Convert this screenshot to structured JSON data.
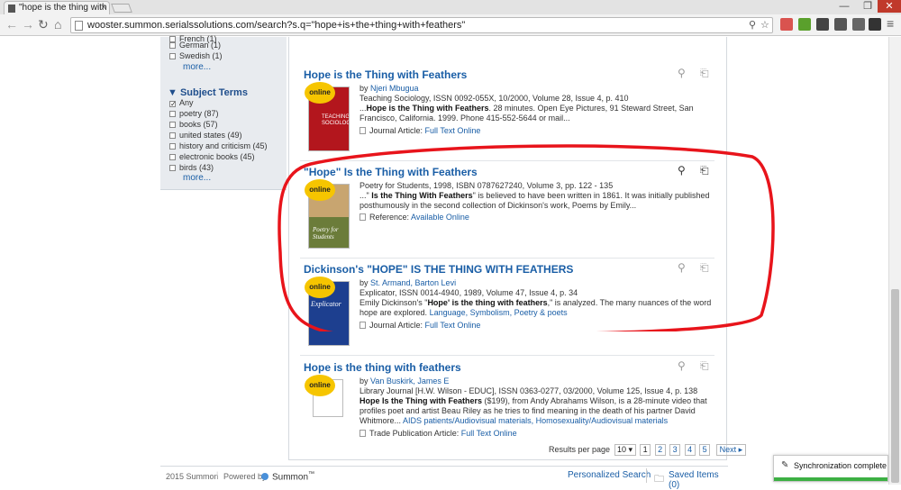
{
  "browser": {
    "tab_title": "\"hope is the thing with fe",
    "tab_close": "×",
    "url": "wooster.summon.serialssolutions.com/search?s.q=\"hope+is+the+thing+with+feathers\"",
    "window_controls": [
      "—",
      "❐",
      "✕"
    ]
  },
  "sidebar": {
    "language_items": [
      {
        "label": "French (1)"
      },
      {
        "label": "German (1)"
      },
      {
        "label": "Swedish (1)"
      }
    ],
    "language_more": "more...",
    "subject_heading": "Subject Terms",
    "subject_items": [
      {
        "label": "Any",
        "checked": true
      },
      {
        "label": "poetry (87)",
        "checked": false
      },
      {
        "label": "books (57)",
        "checked": false
      },
      {
        "label": "united states (49)",
        "checked": false
      },
      {
        "label": "history and criticism (45)",
        "checked": false
      },
      {
        "label": "electronic books (45)",
        "checked": false
      },
      {
        "label": "birds (43)",
        "checked": false
      }
    ],
    "subject_more": "more..."
  },
  "results": [
    {
      "title": "Hope is the Thing with Feathers",
      "badge": "online",
      "authors_prefix": "by ",
      "authors": "Njeri Mbugua",
      "source": "Teaching Sociology, ISSN 0092-055X, 10/2000, Volume 28, Issue 4, p. 410",
      "snippet_pre": "...",
      "snippet_bold": "Hope is the Thing with Feathers",
      "snippet_post": ". 28 minutes. Open Eye Pictures, 91 Steward Street, San Francisco, California. 1999. Phone 415-552-5644 or mail...",
      "type": "Journal Article:",
      "access": "Full Text Online",
      "cover_color": "#b3161d",
      "cover_text": "TEACHING SOCIOLOGY"
    },
    {
      "title": "\"Hope\" Is the Thing with Feathers",
      "badge": "online",
      "source": "Poetry for Students, 1998, ISBN 0787627240, Volume 3, pp. 122 - 135",
      "snippet_pre": "...\"",
      "snippet_bold": " Is the Thing With Feathers",
      "snippet_post": "\" is believed to have been written in 1861. It was initially published posthumously in the second collection of Dickinson's work, Poems by Emily...",
      "type": "Reference:",
      "access": "Available Online",
      "cover_color": "#6b7c3a",
      "cover_text": "Poetry for Students"
    },
    {
      "title": "Dickinson's \"HOPE\" IS THE THING WITH FEATHERS",
      "badge": "online",
      "authors_prefix": "by ",
      "authors": "St. Armand, Barton Levi",
      "source": "Explicator, ISSN 0014-4940, 1989, Volume 47, Issue 4, p. 34",
      "snippet_pre": "Emily Dickinson's \"",
      "snippet_bold": "Hope' is the thing with feathers",
      "snippet_post": ",\" is analyzed. The many nuances of the word hope are explored. ",
      "subjects": "Language, Symbolism, Poetry & poets",
      "type": "Journal Article:",
      "access": "Full Text Online",
      "cover_color": "#1d3f8f",
      "cover_text": "Explicator"
    },
    {
      "title": "Hope is the thing with feathers",
      "badge": "online",
      "authors_prefix": "by ",
      "authors": "Van Buskirk, James E",
      "source": "Library Journal [H.W. Wilson - EDUC], ISSN 0363-0277, 03/2000, Volume 125, Issue 4, p. 138",
      "snippet_bold": "Hope Is the Thing with Feathers",
      "snippet_post": " ($199), from Andy Abrahams Wilson, is a 28-minute video that profiles poet and artist Beau Riley as he tries to find meaning in the death of his partner David Whitmore... ",
      "subjects": "AIDS patients/Audiovisual materials, Homosexuality/Audiovisual materials",
      "type": "Trade Publication Article:",
      "access": "Full Text Online"
    }
  ],
  "pager": {
    "label": "Results per page",
    "per_page": "10 ▾",
    "pages": [
      "1",
      "2",
      "3",
      "4",
      "5"
    ],
    "next": "Next ▸"
  },
  "footer": {
    "copyright": "2015 Summon",
    "powered_by": "Powered by",
    "brand": "Summon",
    "brand_tm": "™",
    "personalized_search": "Personalized Search",
    "saved_items": "Saved Items (0)"
  },
  "sync_toast": {
    "text": "Synchronization complete"
  },
  "colors": {
    "link": "#1a5ea6",
    "badge": "#f6c500",
    "highlight": "#e8141b",
    "sync_bar": "#3cb043"
  }
}
